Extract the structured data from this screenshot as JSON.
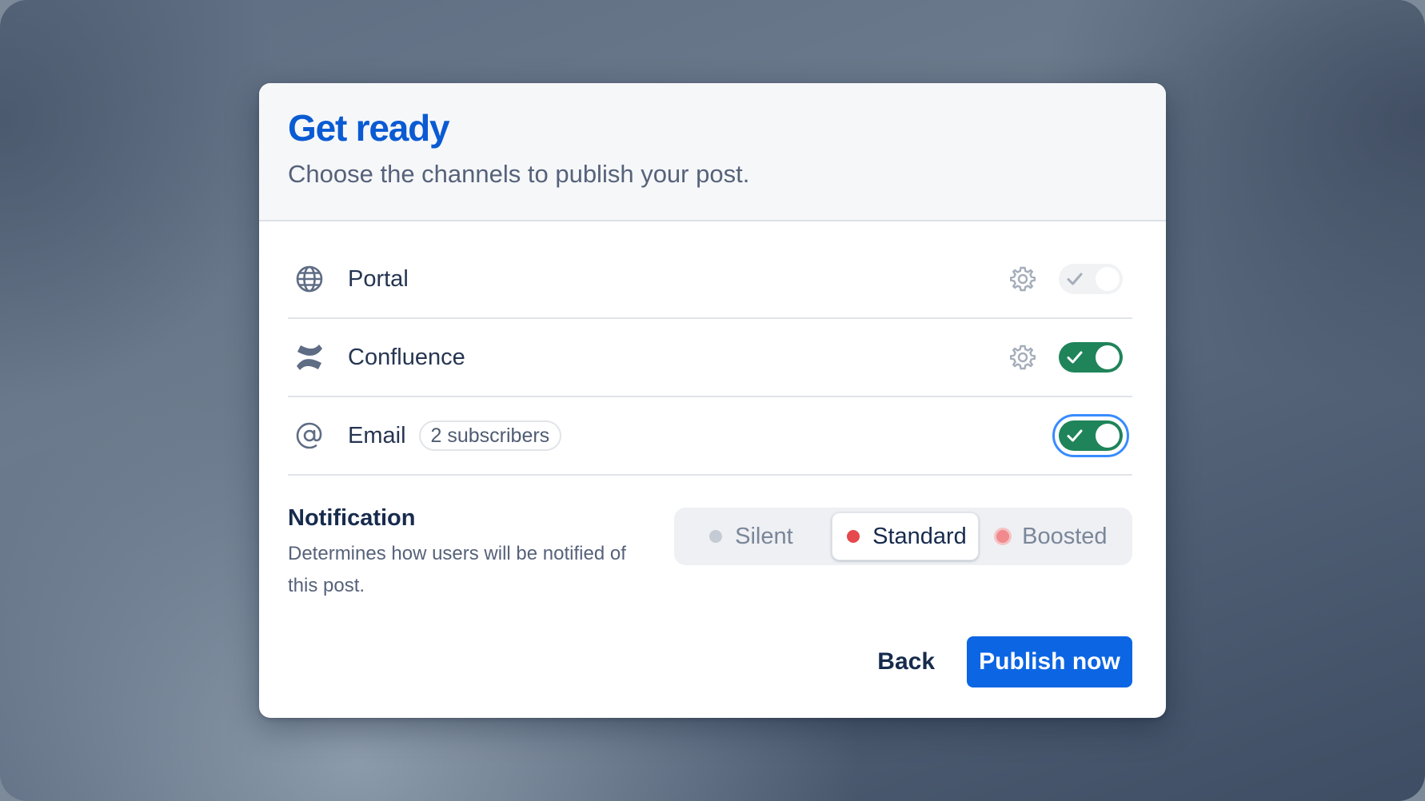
{
  "dialog": {
    "title": "Get ready",
    "subtitle": "Choose the channels to publish your post."
  },
  "channels": [
    {
      "label": "Portal",
      "icon": "globe-icon",
      "has_settings": true,
      "enabled": false
    },
    {
      "label": "Confluence",
      "icon": "confluence-logo-icon",
      "has_settings": true,
      "enabled": true
    },
    {
      "label": "Email",
      "icon": "at-sign-icon",
      "badge": "2 subscribers",
      "has_settings": false,
      "enabled": true,
      "focused": true
    }
  ],
  "notification": {
    "title": "Notification",
    "description": "Determines how users will be notified of this post.",
    "options": [
      "Silent",
      "Standard",
      "Boosted"
    ],
    "selected": "Standard"
  },
  "footer": {
    "back_label": "Back",
    "publish_label": "Publish now"
  },
  "colors": {
    "accent": "#0c66e4",
    "title": "#0a5bd3",
    "toggle_on": "#1f845a",
    "focus_ring": "#388bff",
    "standard_dot": "#e5484d"
  }
}
